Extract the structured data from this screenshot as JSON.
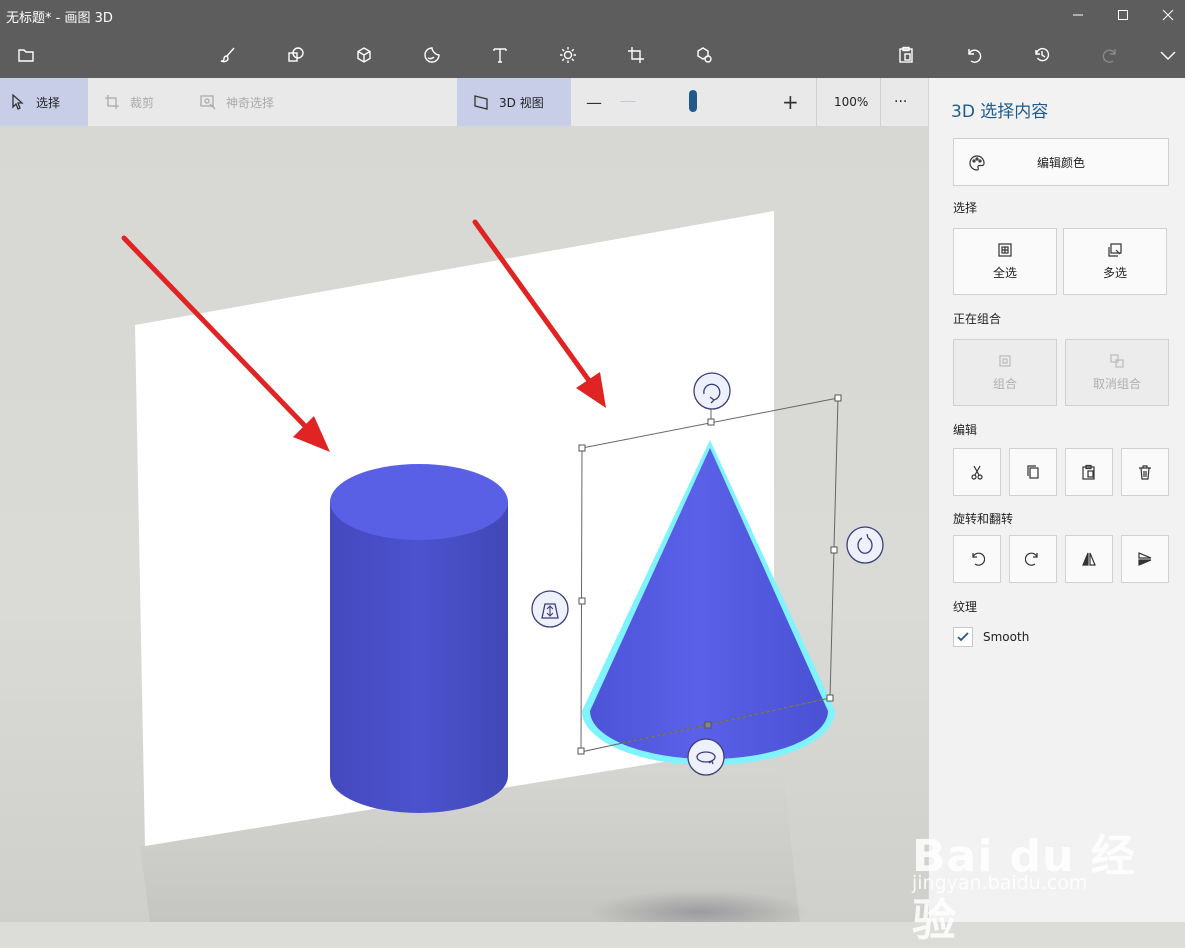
{
  "window": {
    "title": "无标题* - 画图 3D",
    "minimize_icon": "minimize-icon",
    "maximize_icon": "maximize-icon",
    "close_icon": "close-icon"
  },
  "toolbar": {
    "items": [
      {
        "name": "menu-folder-icon"
      },
      {
        "name": "brush-icon"
      },
      {
        "name": "2d-shapes-icon"
      },
      {
        "name": "3d-shapes-icon"
      },
      {
        "name": "stickers-icon"
      },
      {
        "name": "text-icon",
        "glyph": "T"
      },
      {
        "name": "effects-icon"
      },
      {
        "name": "canvas-icon"
      },
      {
        "name": "3d-library-icon"
      },
      {
        "name": "paste-icon"
      },
      {
        "name": "undo-icon"
      },
      {
        "name": "history-icon"
      },
      {
        "name": "redo-icon"
      },
      {
        "name": "expand-icon"
      }
    ]
  },
  "subbar": {
    "select_label": "选择",
    "crop_label": "裁剪",
    "magic_select_label": "神奇选择",
    "view3d_label": "3D 视图",
    "zoom_minus": "—",
    "zoom_plus": "+",
    "zoom_value": "100%",
    "zoom_fraction": 0.5,
    "more": "···"
  },
  "panel": {
    "title": "3D 选择内容",
    "edit_color_label": "编辑颜色",
    "select_section": "选择",
    "select_all_label": "全选",
    "multi_select_label": "多选",
    "group_section": "正在组合",
    "group_label": "组合",
    "ungroup_label": "取消组合",
    "edit_section": "编辑",
    "rotate_section": "旋转和翻转",
    "texture_section": "纹理",
    "smooth_label": "Smooth",
    "smooth_checked": true
  },
  "watermark": {
    "logo_text": "Bai du 经验",
    "url": "jingyan.baidu.com"
  },
  "colors": {
    "titlebar": "#5d5d5d",
    "object_blue": "#5259e0",
    "selection_glow": "#7ff3ff",
    "arrow_red": "#e02424",
    "accent": "#1f5a8a"
  }
}
